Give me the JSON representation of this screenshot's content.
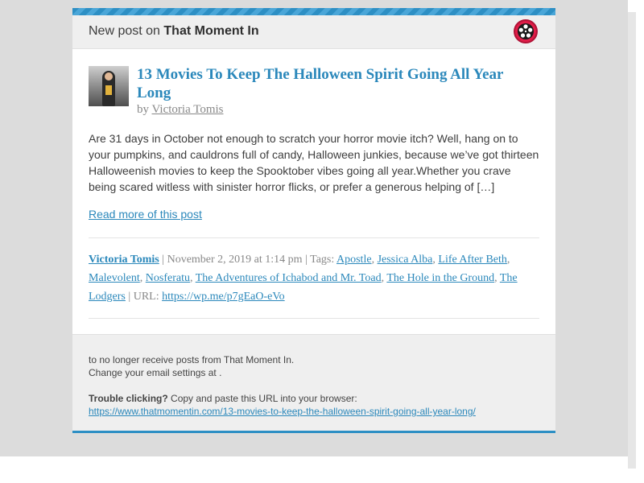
{
  "header": {
    "prefix": "New post on",
    "site_name": "That Moment In",
    "icon": "film-reel-icon"
  },
  "post": {
    "title": "13 Movies To Keep The Halloween Spirit Going All Year Long",
    "by_label": "by",
    "author": "Victoria Tomis",
    "excerpt": "Are 31 days in October not enough to scratch your horror movie itch? Well, hang on to your pumpkins, and cauldrons full of candy, Halloween junkies, because we’ve got thirteen Halloweenish movies to keep the Spooktober vibes going all year.Whether you crave being scared witless with sinister horror flicks, or prefer a generous helping of […]",
    "read_more": "Read more of this post"
  },
  "meta": {
    "author": "Victoria Tomis",
    "date": "November 2, 2019 at 1:14 pm",
    "tags_label": "Tags:",
    "tags": [
      "Apostle",
      "Jessica Alba",
      "Life After Beth",
      "Malevolent",
      "Nosferatu",
      "The Adventures of Ichabod and Mr. Toad",
      "The Hole in the Ground",
      "The Lodgers"
    ],
    "url_label": "URL:",
    "short_url": "https://wp.me/p7gEaO-eVo"
  },
  "footer": {
    "unsubscribe": "to no longer receive posts from That Moment In.",
    "settings": "Change your email settings at .",
    "trouble_bold": "Trouble clicking?",
    "trouble_text": "Copy and paste this URL into your browser:",
    "full_url": "https://www.thatmomentin.com/13-movies-to-keep-the-halloween-spirit-going-all-year-long/"
  },
  "colors": {
    "accent": "#2b88bb",
    "stripe": "#2d8fc4",
    "site_icon": "#e01d48"
  }
}
